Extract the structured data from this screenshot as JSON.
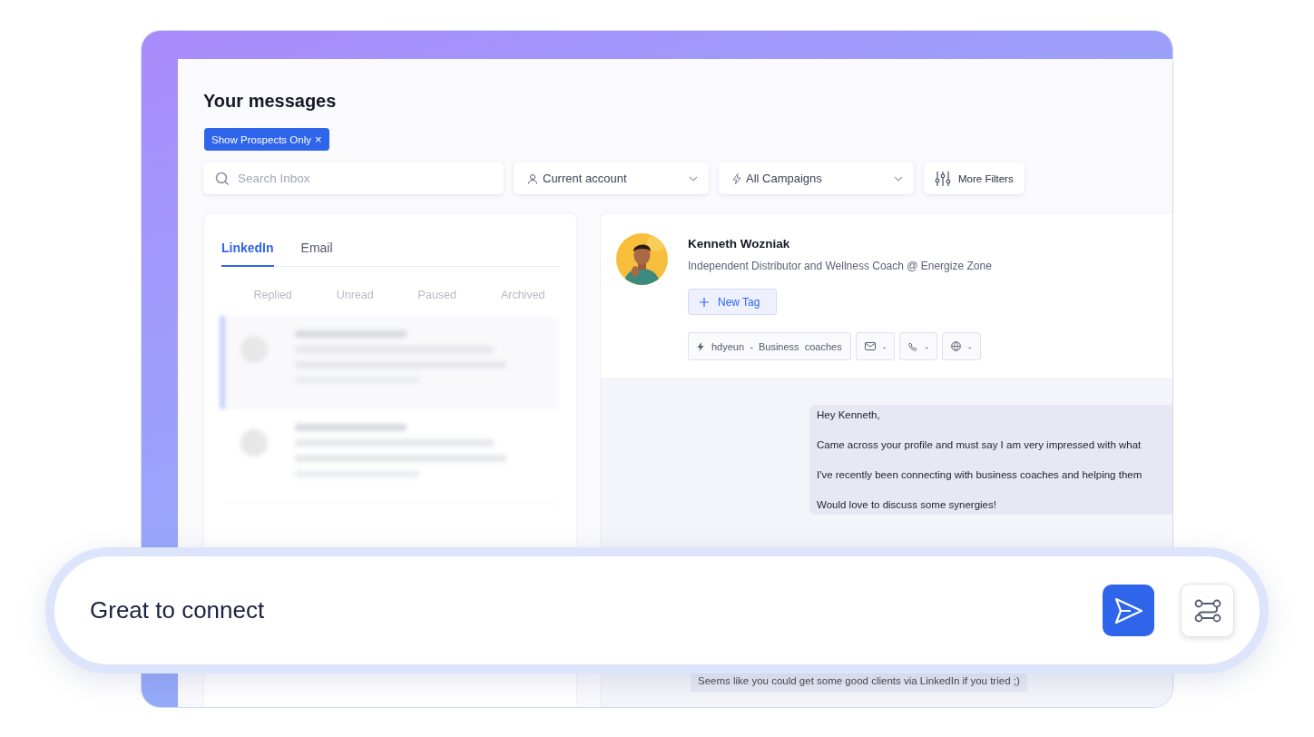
{
  "page": {
    "title": "Your messages"
  },
  "filter_chip": {
    "label": "Show Prospects Only",
    "close": "×"
  },
  "search": {
    "placeholder": "Search Inbox"
  },
  "filters": [
    {
      "kind": "account",
      "label": "Current account"
    },
    {
      "kind": "campaign",
      "label": "All Campaigns"
    }
  ],
  "more_filters": {
    "label": "More Filters"
  },
  "channel_tabs": [
    {
      "label": "LinkedIn",
      "selected": true
    },
    {
      "label": "Email",
      "selected": false
    }
  ],
  "status_tabs": [
    {
      "label": "Replied"
    },
    {
      "label": "Unread"
    },
    {
      "label": "Paused"
    },
    {
      "label": "Archived"
    }
  ],
  "conversations": [
    {
      "selected": true
    },
    {
      "selected": false
    }
  ],
  "contact": {
    "name": "Kenneth Wozniak",
    "headline": "Independent Distributor and Wellness Coach @ Energize Zone",
    "new_tag": "New Tag",
    "details": [
      {
        "kind": "campaign",
        "text": "hdyeun  -  Business  coaches"
      },
      {
        "kind": "email",
        "text": "-"
      },
      {
        "kind": "phone",
        "text": "-"
      },
      {
        "kind": "website",
        "text": "-"
      }
    ]
  },
  "messages": [
    {
      "lines": [
        "Hey Kenneth,",
        "Came across your profile and must say I am very impressed with what",
        "I've recently been connecting with business coaches and helping them",
        "Would love to discuss some synergies!"
      ]
    },
    {
      "lines": [
        "Seems like you could get some good clients via LinkedIn if you tried ;)"
      ]
    }
  ],
  "composer": {
    "value": "Great to connect"
  }
}
